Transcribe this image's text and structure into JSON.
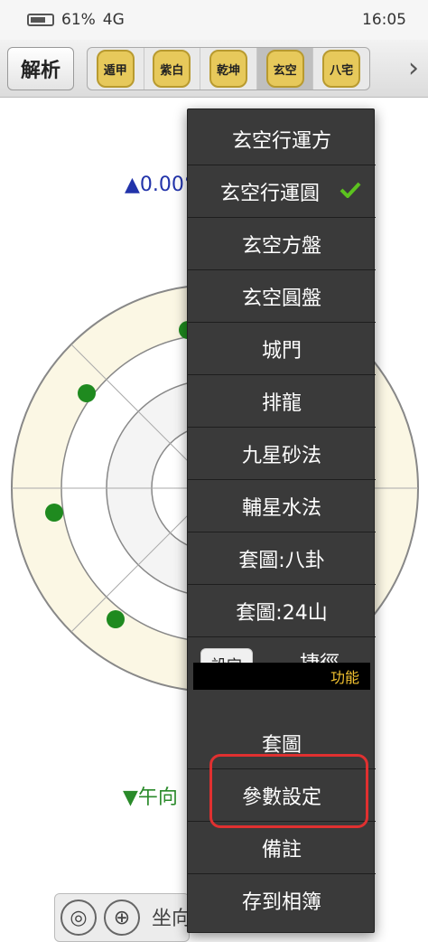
{
  "statusbar": {
    "time": "16:05",
    "left_text": "61%",
    "signal_text": "4G"
  },
  "toolbar": {
    "analyze_label": "解析",
    "tabs": [
      {
        "label": "遁甲"
      },
      {
        "label": "紫白"
      },
      {
        "label": "乾坤"
      },
      {
        "label": "玄空"
      },
      {
        "label": "八宅"
      }
    ]
  },
  "background": {
    "degree": "▲0.00°",
    "facing": "▼午向",
    "bottom_label": "坐向"
  },
  "menu": {
    "items": [
      {
        "label": "玄空行運方"
      },
      {
        "label": "玄空行運圓",
        "checked": true
      },
      {
        "label": "玄空方盤"
      },
      {
        "label": "玄空圓盤"
      },
      {
        "label": "城門"
      },
      {
        "label": "排龍"
      },
      {
        "label": "九星砂法"
      },
      {
        "label": "輔星水法"
      },
      {
        "label": "套圖:八卦"
      },
      {
        "label": "套圖:24山"
      },
      {
        "label": "捷徑",
        "button": "設定"
      }
    ],
    "section_label": "功能",
    "function_items": [
      {
        "label": "套圖"
      },
      {
        "label": "參數設定"
      },
      {
        "label": "備註"
      },
      {
        "label": "存到相簿"
      }
    ]
  },
  "colors": {
    "menu_bg": "#3a3a3a",
    "check": "#5cc21f",
    "highlight": "#e03030",
    "section_text": "#f2c230"
  }
}
